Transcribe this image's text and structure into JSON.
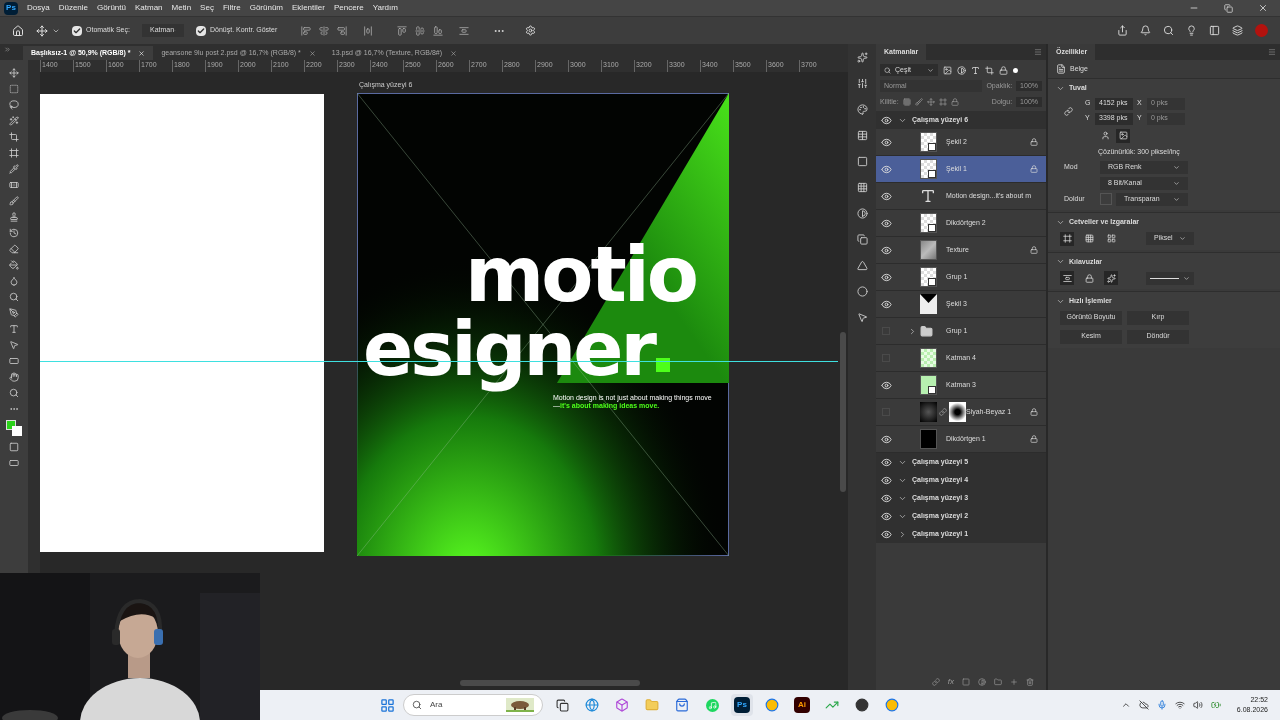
{
  "app_logo": "Ps",
  "menu": [
    "Dosya",
    "Düzenle",
    "Görüntü",
    "Katman",
    "Metin",
    "Seç",
    "Filtre",
    "Görünüm",
    "Eklentiler",
    "Pencere",
    "Yardım"
  ],
  "options_bar": {
    "auto_select": {
      "label": "Otomatik Seç:",
      "checked": true
    },
    "auto_select_target": "Katman",
    "transform_controls": {
      "label": "Dönüşt. Kontr. Göster",
      "checked": true
    }
  },
  "tabs": [
    {
      "label": "Başlıksız-1 @ 50,9% (RGB/8) *",
      "selected": true
    },
    {
      "label": "geansone 9lu post 2.psd @ 16,7% (RGB/8) *",
      "selected": false
    },
    {
      "label": "13.psd @ 16,7% (Texture, RGB/8#)",
      "selected": false
    }
  ],
  "ruler_labels": [
    "1400",
    "1500",
    "1600",
    "1700",
    "1800",
    "1900",
    "2000",
    "2100",
    "2200",
    "2300",
    "2400",
    "2500",
    "2600",
    "2700",
    "2800",
    "2900",
    "3000",
    "3100",
    "3200",
    "3300",
    "3400",
    "3500",
    "3600",
    "3700"
  ],
  "canvas": {
    "artboard_label": "Çalışma yüzeyi 6",
    "headline_1": "motio",
    "headline_2": "esigner",
    "body": "Motion design is not just about making things move—",
    "body_highlight": "it's about making ideas move."
  },
  "layers_panel": {
    "title": "Katmanlar",
    "filter": "Çeşit",
    "blend_mode": "Normal",
    "opacity_label": "Opaklık:",
    "opacity": "100%",
    "lock_label": "Kilitle:",
    "fill_label": "Dolgu:",
    "fill": "100%",
    "fx_label": "fx",
    "layers": [
      {
        "name": "Çalışma yüzeyi 6",
        "kind": "artboard",
        "visible": true,
        "expanded": true,
        "selected": false,
        "children": [
          {
            "name": "Şekil 2",
            "kind": "shape",
            "visible": true,
            "locked": true,
            "selected": false
          },
          {
            "name": "Şekil 1",
            "kind": "shape",
            "visible": true,
            "locked": true,
            "selected": true
          },
          {
            "name": "Motion design...it's about m",
            "kind": "text",
            "visible": true,
            "locked": false,
            "selected": false
          },
          {
            "name": "Dikdörtgen 2",
            "kind": "shape",
            "visible": true,
            "locked": false,
            "selected": false
          },
          {
            "name": "Texture",
            "kind": "texture",
            "visible": true,
            "locked": true,
            "selected": false
          },
          {
            "name": "Grup 1",
            "kind": "smart",
            "visible": true,
            "locked": false,
            "selected": false
          },
          {
            "name": "Şekil 3",
            "kind": "triangle",
            "visible": true,
            "locked": false,
            "selected": false
          },
          {
            "name": "Grup 1",
            "kind": "folder",
            "visible": false,
            "locked": false,
            "selected": false,
            "expanded": false
          },
          {
            "name": "Katman 4",
            "kind": "pixel",
            "visible": false,
            "locked": false,
            "selected": false
          },
          {
            "name": "Katman 3",
            "kind": "pixel-smart",
            "visible": true,
            "locked": false,
            "selected": false
          },
          {
            "name": "Siyah-Beyaz 1",
            "kind": "adjustment",
            "visible": false,
            "locked": true,
            "selected": false
          },
          {
            "name": "Dikdörtgen 1",
            "kind": "black",
            "visible": true,
            "locked": true,
            "selected": false
          }
        ]
      },
      {
        "name": "Çalışma yüzeyi 5",
        "kind": "artboard",
        "visible": true,
        "expanded": true,
        "selected": false
      },
      {
        "name": "Çalışma yüzeyi 4",
        "kind": "artboard",
        "visible": true,
        "expanded": true,
        "selected": false
      },
      {
        "name": "Çalışma yüzeyi 3",
        "kind": "artboard",
        "visible": true,
        "expanded": true,
        "selected": false
      },
      {
        "name": "Çalışma yüzeyi 2",
        "kind": "artboard",
        "visible": true,
        "expanded": true,
        "selected": false
      },
      {
        "name": "Çalışma yüzeyi 1",
        "kind": "artboard",
        "visible": true,
        "expanded": false,
        "selected": false
      }
    ]
  },
  "properties": {
    "title": "Özellikler",
    "doc_label": "Belge",
    "canvas": {
      "title": "Tuval",
      "expanded": true,
      "width_label": "G",
      "width": "4152 pks",
      "x_label": "X",
      "x": "0 pks",
      "height_label": "Y",
      "height": "3398 pks",
      "y_label": "Y",
      "y": "0 pks",
      "orientations": [
        {
          "kind": "portrait",
          "selected": false
        },
        {
          "kind": "landscape",
          "selected": true
        }
      ],
      "resolution": "Çözünürlük: 300 piksel/inç",
      "mode_label": "Mod",
      "mode": "RGB Renk",
      "depth": "8 Bit/Kanal",
      "fill_label": "Doldur",
      "fill": "Transparan"
    },
    "rulers": {
      "title": "Cetveller ve Izgaralar",
      "expanded": true,
      "toggles": [
        {
          "kind": "ruler",
          "selected": true
        },
        {
          "kind": "grid",
          "selected": false
        },
        {
          "kind": "pixel-grid",
          "selected": false
        }
      ],
      "unit": "Piksel"
    },
    "guides": {
      "title": "Kılavuzlar",
      "expanded": true,
      "toggles": [
        {
          "kind": "guides",
          "selected": true
        },
        {
          "kind": "lock-guides",
          "selected": false
        },
        {
          "kind": "smart-guides",
          "selected": true
        }
      ]
    },
    "quick_actions": {
      "title": "Hızlı İşlemler",
      "expanded": true,
      "buttons": [
        "Görüntü Boyutu",
        "Kırp",
        "Kesim",
        "Döndür"
      ]
    }
  },
  "taskbar": {
    "search": "Ara",
    "apps": [
      {
        "kind": "taskview",
        "selected": false
      },
      {
        "kind": "edge",
        "selected": false
      },
      {
        "kind": "m365",
        "selected": false
      },
      {
        "kind": "folder",
        "selected": false
      },
      {
        "kind": "store",
        "selected": false
      },
      {
        "kind": "spotify",
        "selected": false
      },
      {
        "kind": "ps",
        "label": "Ps",
        "selected": true
      },
      {
        "kind": "chrome",
        "selected": false
      },
      {
        "kind": "ai",
        "label": "Ai",
        "selected": false
      },
      {
        "kind": "chart",
        "selected": false
      },
      {
        "kind": "obs",
        "selected": false
      },
      {
        "kind": "chrome",
        "selected": false
      }
    ],
    "time": "22:52",
    "date": "6.08.2026"
  }
}
